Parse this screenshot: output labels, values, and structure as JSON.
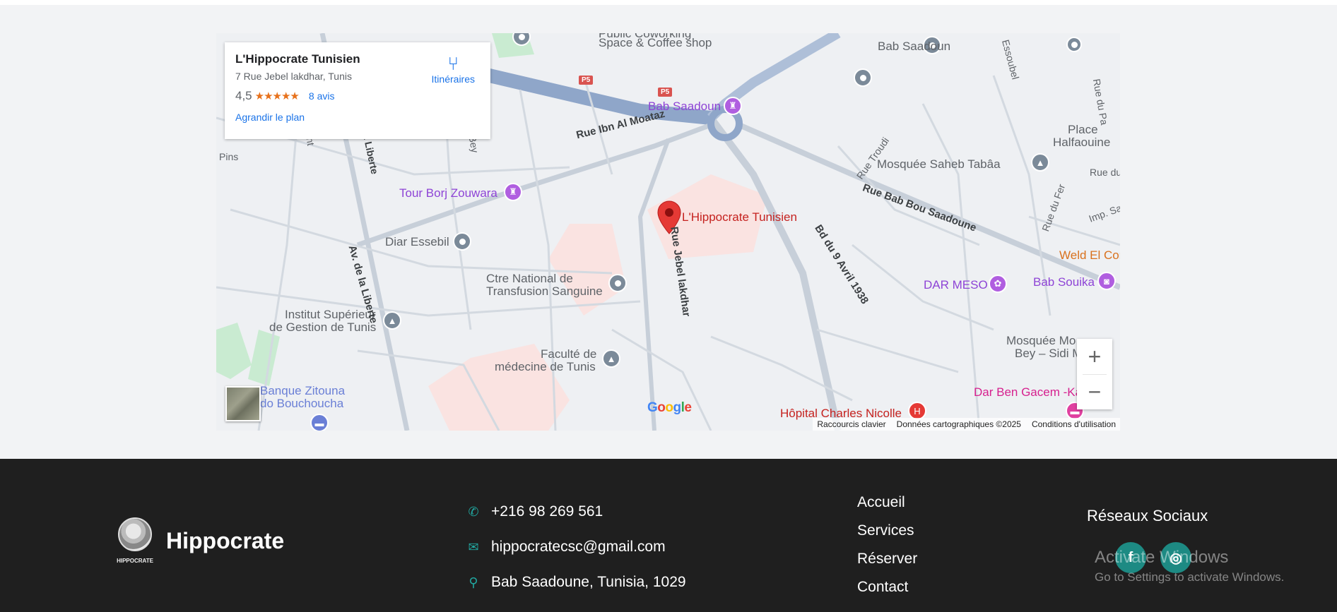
{
  "map": {
    "card": {
      "name": "L'Hippocrate Tunisien",
      "address": "7 Rue Jebel lakdhar, Tunis",
      "rating": "4,5",
      "stars": "★★★★★",
      "reviews": "8 avis",
      "enlarge": "Agrandir le plan",
      "directions": "Itinéraires"
    },
    "labels": {
      "marker": "L'Hippocrate Tunisien",
      "bab_saadoun": "Bab Saadoun",
      "bab_saadoun_top": "Bab Saadoun",
      "public_coworking": "Public Coworking",
      "space_coffee": "Space & Coffee shop",
      "bab_saadoun_small": "Bab Saadoun",
      "rue_ibn_al_moataz": "Rue Ibn Al Moataz",
      "tour_borj": "Tour Borj Zouwara",
      "diar_essebil": "Diar Essebil",
      "ctre_national_1": "Ctre National de",
      "ctre_national_2": "Transfusion Sanguine",
      "institut_1": "Institut Supérieur",
      "institut_2": "de Gestion de Tunis",
      "faculte_1": "Faculté de",
      "faculte_2": "médecine de Tunis",
      "banque_1": "Banque Zitouna",
      "banque_2": "do Bouchoucha",
      "rue_jebel": "Rue Jebel lakdhar",
      "av_liberte": "Av. de la Liberte",
      "av_liberte2": "Av. de la Liberte",
      "rue_militant": "Militant",
      "rue_bey": "Bey",
      "pins": "Pins",
      "mosquee_saheb": "Mosquée Saheb Tabâa",
      "place_1": "Place",
      "place_2": "Halfaouine",
      "rue_bab_bou": "Rue Bab Bou Saadoune",
      "bd_9_avril": "Bd du 9 Avril 1938",
      "rue_troudi": "Rue Troudi",
      "rue_du_fer": "Rue du Fer",
      "dar_meso": "DAR MESO",
      "bab_souika": "Bab Souika",
      "weld_el_cor": "Weld El Cor",
      "mosquee_moi_1": "Mosquée Mo",
      "mosquee_moi_2": "Bey – Sidi M",
      "dar_ben_gacem": "Dar Ben Gacem -Ka",
      "hopital": "Hôpital Charles Nicolle",
      "essoubel": "Essoubel",
      "rue_du_pa": "Rue du Pa",
      "rue_du": "Rue du",
      "imp_sa": "Imp. Sa",
      "p5_a": "P5",
      "p5_b": "P5"
    },
    "google": "Google",
    "attribution": {
      "shortcuts": "Raccourcis clavier",
      "data": "Données cartographiques ©2025",
      "terms": "Conditions d'utilisation"
    },
    "zoom_in": "+",
    "zoom_out": "−"
  },
  "footer": {
    "brand": "Hippocrate",
    "logo_caption": "HIPPOCRATE",
    "phone": "+216 98 269 561",
    "email": "hippocratecsc@gmail.com",
    "address": "Bab Saadoune, Tunisia, 1029",
    "nav": [
      "Accueil",
      "Services",
      "Réserver",
      "Contact"
    ],
    "social_title": "Réseaux Sociaux",
    "social": [
      {
        "label": "f",
        "icon": "facebook-icon"
      },
      {
        "label": "◎",
        "icon": "instagram-icon"
      }
    ],
    "watermark_title": "Activate Windows",
    "watermark_sub": "Go to Settings to activate Windows."
  },
  "colors": {
    "footer_bg": "#1f1f1f",
    "accent_teal": "#21a7a0",
    "link_blue": "#1a73e8",
    "marker_red": "#e53935"
  }
}
